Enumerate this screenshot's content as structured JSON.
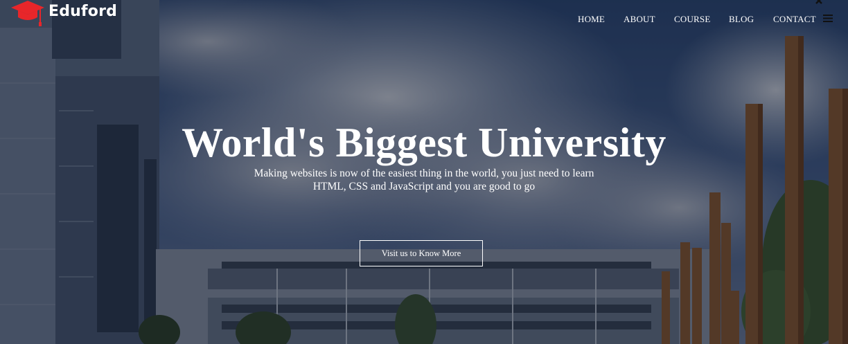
{
  "brand": {
    "name": "Eduford",
    "logo_icon": "graduation-cap-icon",
    "logo_color": "#e8262a"
  },
  "nav": {
    "items": [
      {
        "label": "HOME"
      },
      {
        "label": "ABOUT"
      },
      {
        "label": "COURSE"
      },
      {
        "label": "BLOG"
      },
      {
        "label": "CONTACT"
      }
    ],
    "close_icon": "close-icon",
    "menu_icon": "hamburger-menu-icon"
  },
  "hero": {
    "title": "World's Biggest University",
    "subtitle": "Making websites is now of the easiest thing in the world, you just need to learn HTML, CSS and JavaScript and you are good to go",
    "cta_label": "Visit us to Know More"
  },
  "colors": {
    "text": "#ffffff",
    "overlay": "#0c1224",
    "accent": "#e8262a"
  }
}
